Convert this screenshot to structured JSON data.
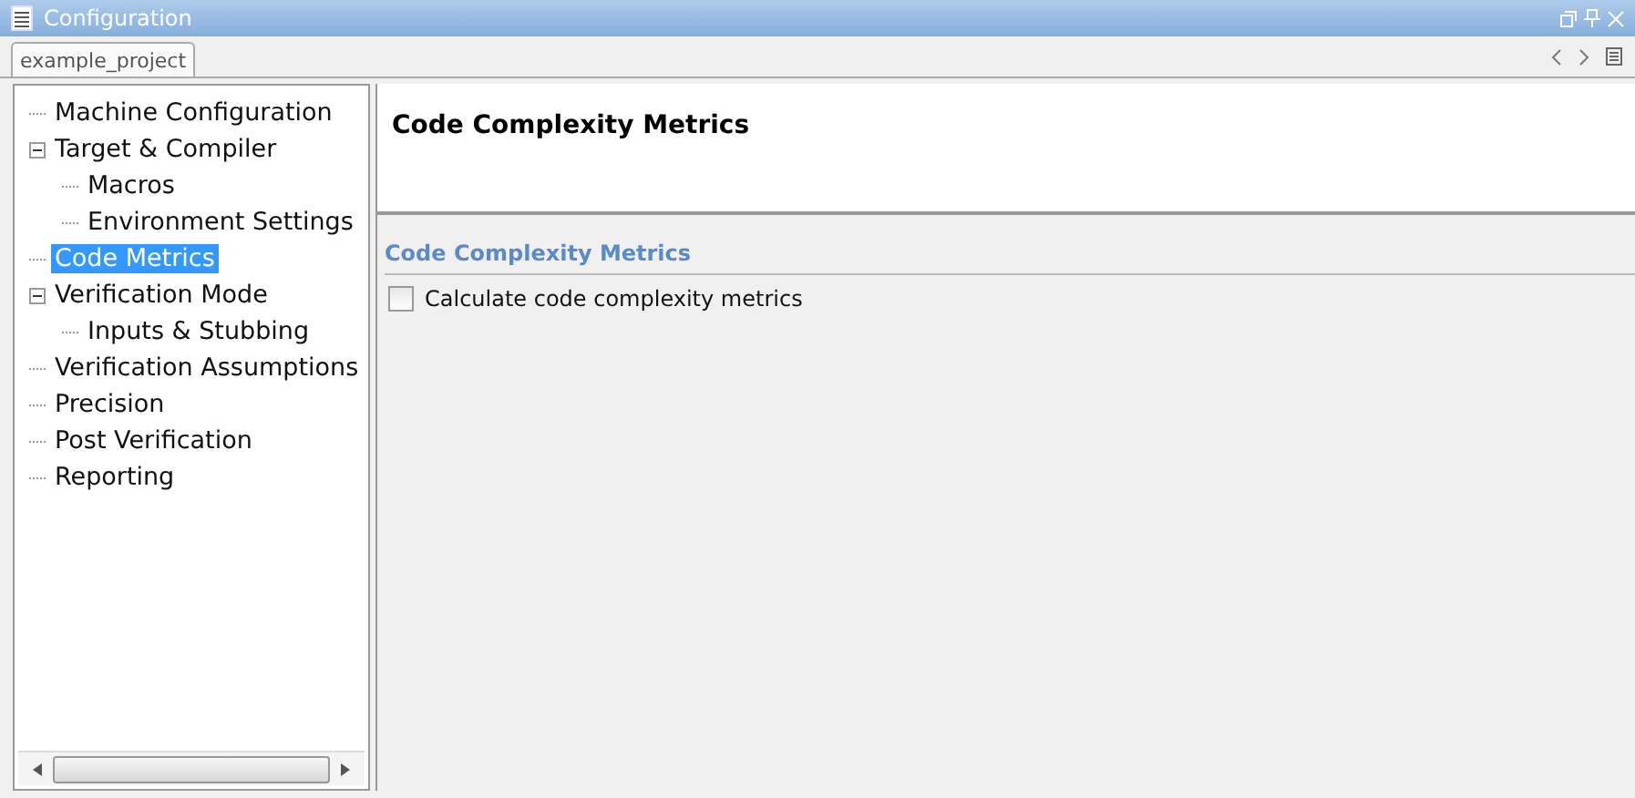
{
  "window": {
    "title": "Configuration"
  },
  "tabs": [
    {
      "label": "example_project",
      "selected": true
    }
  ],
  "tree": [
    {
      "label": "Machine Configuration",
      "selected": false
    },
    {
      "label": "Target & Compiler",
      "selected": false,
      "expanded": true,
      "children": [
        {
          "label": "Macros",
          "selected": false
        },
        {
          "label": "Environment Settings",
          "selected": false
        }
      ]
    },
    {
      "label": "Code Metrics",
      "selected": true
    },
    {
      "label": "Verification Mode",
      "selected": false,
      "expanded": true,
      "children": [
        {
          "label": "Inputs & Stubbing",
          "selected": false
        }
      ]
    },
    {
      "label": "Verification Assumptions",
      "selected": false
    },
    {
      "label": "Precision",
      "selected": false
    },
    {
      "label": "Post Verification",
      "selected": false
    },
    {
      "label": "Reporting",
      "selected": false
    }
  ],
  "header": {
    "title": "Code Complexity Metrics"
  },
  "section": {
    "title": "Code Complexity Metrics",
    "options": [
      {
        "label": "Calculate code complexity metrics",
        "checked": false
      }
    ]
  }
}
